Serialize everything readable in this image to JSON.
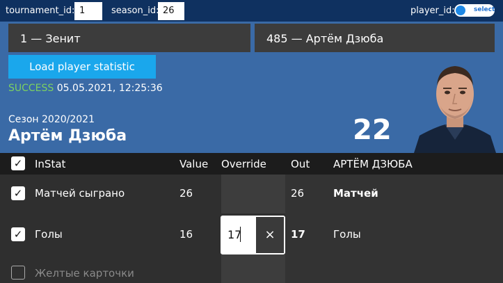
{
  "topbar": {
    "tournament_label": "tournament_id:",
    "tournament_value": "1",
    "season_label": "season_id:",
    "season_value": "26",
    "player_label": "player_id:",
    "player_toggle_text": "select"
  },
  "header": {
    "team_select": "1 — Зенит",
    "player_select": "485 — Артём Дзюба",
    "load_button": "Load player statistic",
    "status_ok": "SUCCESS",
    "status_time": "05.05.2021, 12:25:36",
    "season": "Сезон 2020/2021",
    "player_name": "Артём Дзюба",
    "player_number": "22"
  },
  "table": {
    "headers": {
      "instat": "InStat",
      "value": "Value",
      "override": "Override",
      "out": "Out",
      "player": "АРТЁМ ДЗЮБА"
    },
    "rows": [
      {
        "checked": true,
        "name": "Матчей сыграно",
        "value": "26",
        "override": "",
        "out": "26",
        "label": "Матчей"
      },
      {
        "checked": true,
        "name": "Голы",
        "value": "16",
        "override": "17",
        "out": "17",
        "label": "Голы"
      },
      {
        "checked": false,
        "name": "Желтые карточки",
        "value": "",
        "override": "",
        "out": "",
        "label": ""
      }
    ],
    "clear_icon": "×"
  }
}
